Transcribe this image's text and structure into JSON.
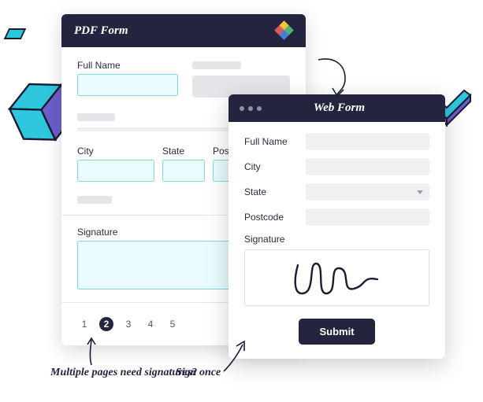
{
  "pdf": {
    "title": "PDF Form",
    "fields": {
      "full_name": "Full Name",
      "city": "City",
      "state": "State",
      "postcode": "Postcode",
      "signature": "Signature"
    },
    "pages": [
      "1",
      "2",
      "3",
      "4",
      "5"
    ],
    "active_page": "2"
  },
  "web": {
    "title": "Web Form",
    "fields": {
      "full_name": "Full Name",
      "city": "City",
      "state": "State",
      "postcode": "Postcode",
      "signature": "Signature"
    },
    "submit": "Submit"
  },
  "annotations": {
    "multi": "Multiple pages need signatures?",
    "once": "Sign once"
  }
}
